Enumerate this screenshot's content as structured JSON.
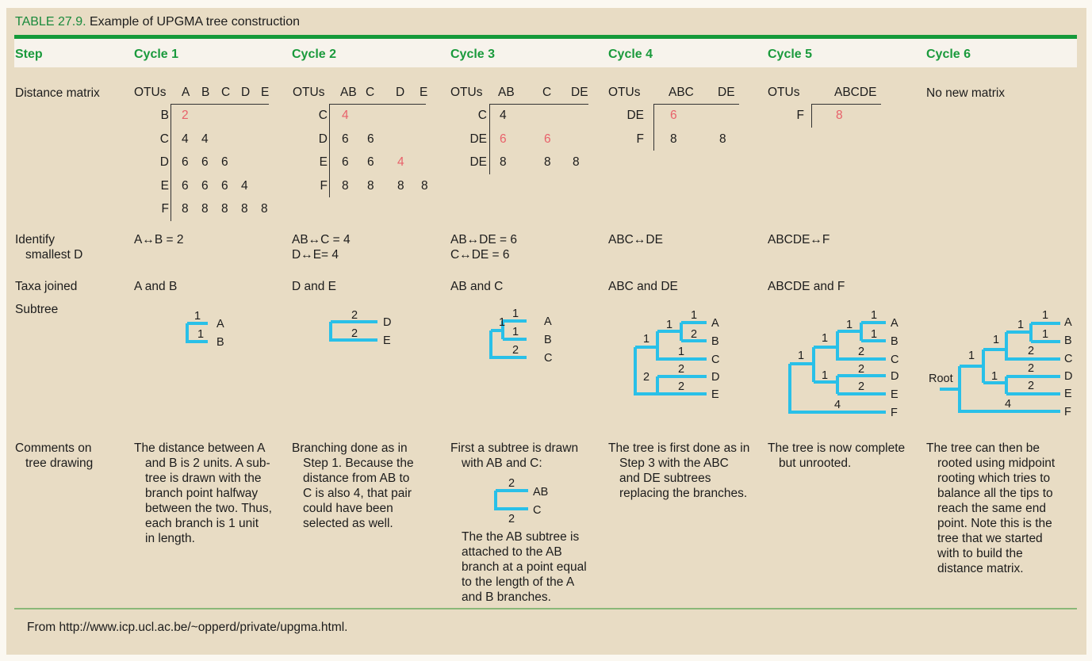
{
  "title": {
    "number": "TABLE 27.9.",
    "text": "Example of UPGMA tree construction"
  },
  "headers": [
    "Step",
    "Cycle 1",
    "Cycle 2",
    "Cycle 3",
    "Cycle 4",
    "Cycle 5",
    "Cycle 6"
  ],
  "row_labels": {
    "distance_matrix": "Distance matrix",
    "identify_1": "Identify",
    "identify_2": "smallest D",
    "taxa_joined": "Taxa joined",
    "subtree": "Subtree",
    "comments_1": "Comments on",
    "comments_2": "tree drawing"
  },
  "matrices": {
    "cycle1": {
      "corner": "OTUs",
      "cols": [
        "A",
        "B",
        "C",
        "D",
        "E"
      ],
      "rows": [
        {
          "label": "B",
          "values": [
            "2"
          ],
          "highlight": [
            0
          ]
        },
        {
          "label": "C",
          "values": [
            "4",
            "4"
          ],
          "highlight": []
        },
        {
          "label": "D",
          "values": [
            "6",
            "6",
            "6"
          ],
          "highlight": []
        },
        {
          "label": "E",
          "values": [
            "6",
            "6",
            "6",
            "4"
          ],
          "highlight": []
        },
        {
          "label": "F",
          "values": [
            "8",
            "8",
            "8",
            "8",
            "8"
          ],
          "highlight": []
        }
      ]
    },
    "cycle2": {
      "corner": "OTUs",
      "cols": [
        "AB",
        "C",
        "D",
        "E"
      ],
      "rows": [
        {
          "label": "C",
          "values": [
            "4"
          ],
          "highlight": [
            0
          ]
        },
        {
          "label": "D",
          "values": [
            "6",
            "6"
          ],
          "highlight": []
        },
        {
          "label": "E",
          "values": [
            "6",
            "6",
            "4"
          ],
          "highlight": [
            2
          ]
        },
        {
          "label": "F",
          "values": [
            "8",
            "8",
            "8",
            "8"
          ],
          "highlight": []
        }
      ]
    },
    "cycle3": {
      "corner": "OTUs",
      "cols": [
        "AB",
        "C",
        "DE"
      ],
      "rows": [
        {
          "label": "C",
          "values": [
            "4"
          ],
          "highlight": []
        },
        {
          "label": "DE",
          "values": [
            "6",
            "6"
          ],
          "highlight": [
            0,
            1
          ]
        },
        {
          "label": "DE",
          "values": [
            "8",
            "8",
            "8"
          ],
          "highlight": []
        }
      ]
    },
    "cycle4": {
      "corner": "OTUs",
      "cols": [
        "ABC",
        "DE"
      ],
      "rows": [
        {
          "label": "DE",
          "values": [
            "6"
          ],
          "highlight": [
            0
          ]
        },
        {
          "label": "F",
          "values": [
            "8",
            "8"
          ],
          "highlight": []
        }
      ]
    },
    "cycle5": {
      "corner": "OTUs",
      "cols": [
        "ABCDE"
      ],
      "rows": [
        {
          "label": "F",
          "values": [
            "8"
          ],
          "highlight": [
            0
          ]
        }
      ]
    },
    "cycle6": {
      "text": "No new matrix"
    }
  },
  "identify": [
    [
      "A↔B = 2"
    ],
    [
      "AB↔C = 4",
      "D↔E= 4"
    ],
    [
      "AB↔DE = 6",
      "C↔DE = 6"
    ],
    [
      "ABC↔DE"
    ],
    [
      "ABCDE↔F"
    ],
    []
  ],
  "taxa_joined": [
    "A and B",
    "D and E",
    "AB and C",
    "ABC and DE",
    "ABCDE and F",
    ""
  ],
  "trees": {
    "cycle1": {
      "leaves": [
        "A",
        "B"
      ],
      "branch_labels": [
        "1",
        "1"
      ]
    },
    "cycle2": {
      "leaves": [
        "D",
        "E"
      ],
      "branch_labels": [
        "2",
        "2"
      ]
    },
    "cycle3": {
      "leaves": [
        "A",
        "B",
        "C"
      ],
      "branch_labels": [
        "1",
        "1",
        "1",
        "2"
      ]
    },
    "cycle4": {
      "leaves": [
        "A",
        "B",
        "C",
        "D",
        "E"
      ],
      "branch_labels": [
        "1",
        "1",
        "1",
        "2",
        "1",
        "2",
        "2"
      ]
    },
    "cycle5": {
      "leaves": [
        "A",
        "B",
        "C",
        "D",
        "E",
        "F"
      ],
      "branch_labels": [
        "1",
        "1",
        "1",
        "1",
        "2",
        "1",
        "2",
        "2",
        "4"
      ]
    },
    "cycle6": {
      "leaves": [
        "A",
        "B",
        "C",
        "D",
        "E",
        "F"
      ],
      "branch_labels": [
        "1",
        "1",
        "1",
        "1",
        "2",
        "1",
        "2",
        "2",
        "4"
      ],
      "root_label": "Root"
    },
    "comment_tree": {
      "leaves": [
        "AB",
        "C"
      ],
      "branch_labels": [
        "2",
        "2"
      ]
    }
  },
  "comments": {
    "cycle1": [
      "The distance between A",
      "and B is 2 units. A sub-",
      "tree is drawn with the",
      "branch point halfway",
      "between the two. Thus,",
      "each branch is 1 unit",
      "in length."
    ],
    "cycle2": [
      "Branching done as in",
      "Step 1. Because the",
      "distance from AB to",
      "C is also 4, that pair",
      "could have been",
      "selected as well."
    ],
    "cycle3_a": [
      "First a subtree is drawn",
      "with AB and C:"
    ],
    "cycle3_b": [
      "The the AB subtree is",
      "attached to the AB",
      "branch at a point equal",
      "to the length of the A",
      "and B branches."
    ],
    "cycle4": [
      "The tree is first done as in",
      "Step 3 with the ABC",
      "and DE subtrees",
      "replacing the branches."
    ],
    "cycle5": [
      "The tree is now complete",
      "but unrooted."
    ],
    "cycle6": [
      "The tree can then be",
      "rooted using midpoint",
      "rooting which tries to",
      "balance all the tips to",
      "reach the same end",
      "point. Note this is the",
      "tree that we started",
      "with to build the",
      "distance matrix."
    ]
  },
  "footer": "From http://www.icp.ucl.ac.be/~opperd/private/upgma.html.",
  "colors": {
    "accent_green": "#159a3a",
    "header_text": "#1a9a3c",
    "highlight_red": "#e8616a",
    "tree_blue": "#29c0e8",
    "panel_bg": "#e8dcc4"
  }
}
